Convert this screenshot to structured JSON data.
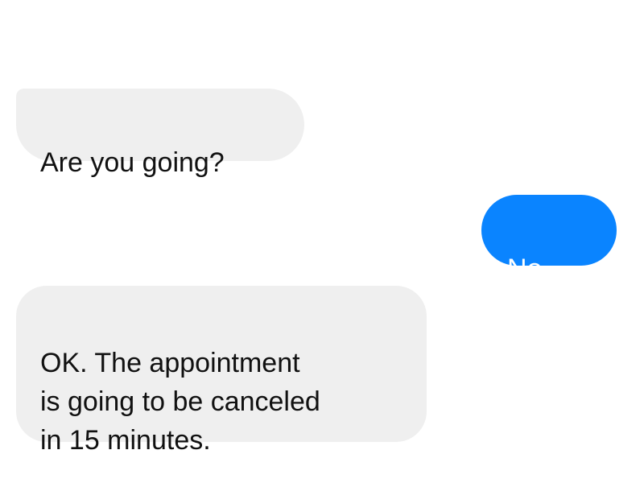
{
  "conversation": {
    "messages": [
      {
        "direction": "incoming",
        "text": "Are you going?"
      },
      {
        "direction": "outgoing",
        "text": "No..."
      },
      {
        "direction": "incoming",
        "text": "OK. The appointment\nis going to be canceled\nin 15 minutes."
      }
    ]
  },
  "colors": {
    "incoming_bubble": "#efefef",
    "outgoing_bubble": "#0a84ff",
    "incoming_text": "#111111",
    "outgoing_text": "#ffffff"
  }
}
